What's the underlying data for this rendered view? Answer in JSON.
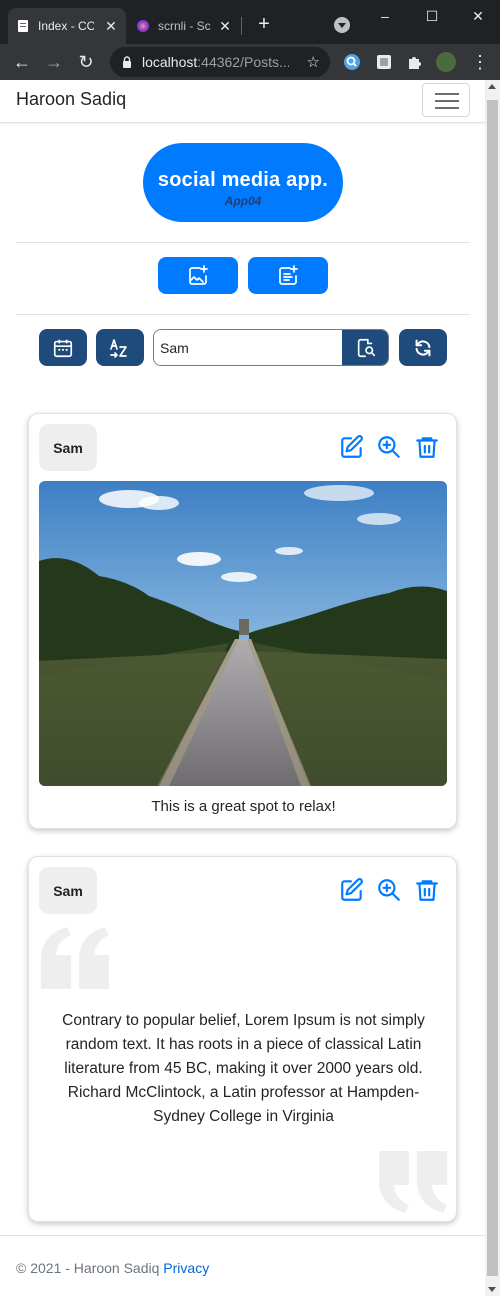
{
  "browser": {
    "tabs": [
      {
        "title": "Index - CO",
        "active": true
      },
      {
        "title": "scrnli - Sc",
        "active": false
      }
    ],
    "new_tab": "+",
    "url_host": "localhost",
    "url_rest": ":44362/Posts...",
    "window_controls": [
      "–",
      "☐",
      "✕"
    ]
  },
  "navbar": {
    "brand": "Haroon Sadiq"
  },
  "hero": {
    "title": "social media app.",
    "subtitle": "App04"
  },
  "search": {
    "value": "Sam"
  },
  "posts": [
    {
      "author": "Sam",
      "type": "image",
      "caption": "This is a great spot to relax!"
    },
    {
      "author": "Sam",
      "type": "quote",
      "text": "Contrary to popular belief, Lorem Ipsum is not simply random text. It has roots in a piece of classical Latin literature from 45 BC, making it over 2000 years old. Richard McClintock, a Latin professor at Hampden-Sydney College in Virginia"
    }
  ],
  "footer": {
    "copyright": "© 2021 - Haroon Sadiq",
    "privacy_link": "Privacy"
  },
  "colors": {
    "primary": "#007bff",
    "dark_button": "#1f4a7c",
    "chrome_dark": "#202124",
    "chrome_toolbar": "#35363a"
  }
}
